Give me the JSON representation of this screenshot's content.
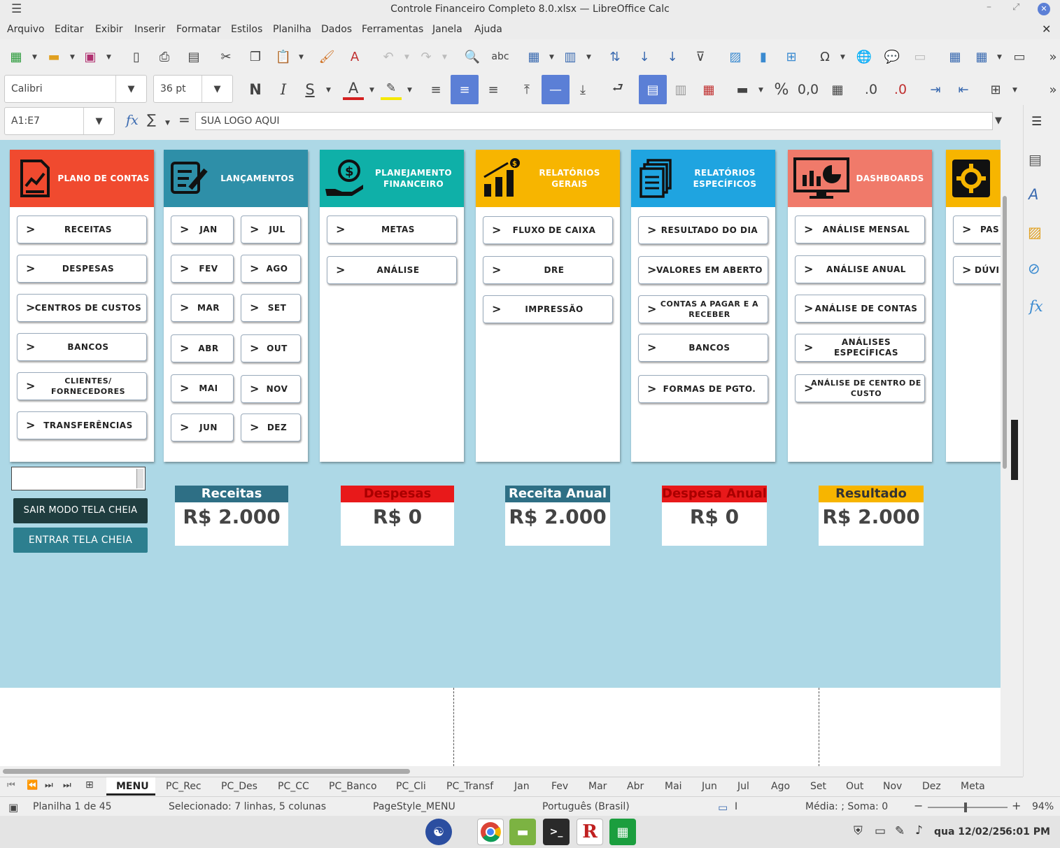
{
  "window": {
    "title": "Controle Financeiro Completo 8.0.xlsx — LibreOffice Calc"
  },
  "menu": [
    "Arquivo",
    "Editar",
    "Exibir",
    "Inserir",
    "Formatar",
    "Estilos",
    "Planilha",
    "Dados",
    "Ferramentas",
    "Janela",
    "Ajuda"
  ],
  "format": {
    "font_name": "Calibri",
    "font_size": "36 pt",
    "number_decimal": "0,0",
    "dec_add": ".0",
    "dec_del": ".0"
  },
  "formula_bar": {
    "name_box": "A1:E7",
    "content": "SUA LOGO AQUI",
    "fx_label": "fx",
    "sum_label": "∑",
    "eq_label": "="
  },
  "panels": {
    "plano": {
      "title": "PLANO DE CONTAS",
      "color": "#f04a2f",
      "buttons": [
        "RECEITAS",
        "DESPESAS",
        "CENTROS DE CUSTOS",
        "BANCOS",
        "CLIENTES/ FORNECEDORES",
        "TRANSFERÊNCIAS"
      ]
    },
    "lanc": {
      "title": "LANÇAMENTOS",
      "color": "#2e8fa8",
      "left": [
        "JAN",
        "FEV",
        "MAR",
        "ABR",
        "MAI",
        "JUN"
      ],
      "right": [
        "JUL",
        "AGO",
        "SET",
        "OUT",
        "NOV",
        "DEZ"
      ]
    },
    "plan": {
      "title": "PLANEJAMENTO FINANCEIRO",
      "color": "#0fb0a8",
      "buttons": [
        "METAS",
        "ANÁLISE"
      ]
    },
    "relg": {
      "title": "RELATÓRIOS GERAIS",
      "color": "#f7b500",
      "buttons": [
        "FLUXO DE CAIXA",
        "DRE",
        "IMPRESSÃO"
      ]
    },
    "rele": {
      "title": "RELATÓRIOS ESPECÍFICOS",
      "color": "#1fa4e0",
      "buttons": [
        "RESULTADO DO DIA",
        "VALORES EM ABERTO",
        "CONTAS A PAGAR E A RECEBER",
        "BANCOS",
        "FORMAS DE PGTO."
      ]
    },
    "dash": {
      "title": "DASHBOARDS",
      "color": "#f07a6a",
      "buttons": [
        "ANÁLISE MENSAL",
        "ANÁLISE ANUAL",
        "ANÁLISE DE CONTAS",
        "ANÁLISES ESPECÍFICAS",
        "ANÁLISE DE CENTRO DE CUSTO"
      ]
    },
    "conf": {
      "color": "#f7b500",
      "buttons": [
        "PAS",
        "DÚVI"
      ]
    }
  },
  "controls": {
    "exit_full": "SAIR MODO TELA CHEIA",
    "enter_full": "ENTRAR TELA CHEIA"
  },
  "kpis": [
    {
      "label": "Receitas",
      "value": "R$ 2.000",
      "color": "#2e6f85"
    },
    {
      "label": "Despesas",
      "value": "R$ 0",
      "color": "#e8191a"
    },
    {
      "label": "Receita Anual",
      "value": "R$ 2.000",
      "color": "#2e6f85"
    },
    {
      "label": "Despesa Anual",
      "value": "R$ 0",
      "color": "#e8191a"
    },
    {
      "label": "Resultado",
      "value": "R$ 2.000",
      "color": "#f7b500"
    }
  ],
  "sheet_tabs": [
    "MENU",
    "PC_Rec",
    "PC_Des",
    "PC_CC",
    "PC_Banco",
    "PC_Cli",
    "PC_Transf",
    "Jan",
    "Fev",
    "Mar",
    "Abr",
    "Mai",
    "Jun",
    "Jul",
    "Ago",
    "Set",
    "Out",
    "Nov",
    "Dez",
    "Meta"
  ],
  "status": {
    "sheet": "Planilha 1 de 45",
    "selection": "Selecionado: 7 linhas, 5 colunas",
    "page_style": "PageStyle_MENU",
    "language": "Português (Brasil)",
    "stats": "Média: ; Soma: 0",
    "zoom": "94%"
  },
  "taskbar": {
    "datetime": "qua 12/02/25",
    "time": "6:01 PM"
  }
}
